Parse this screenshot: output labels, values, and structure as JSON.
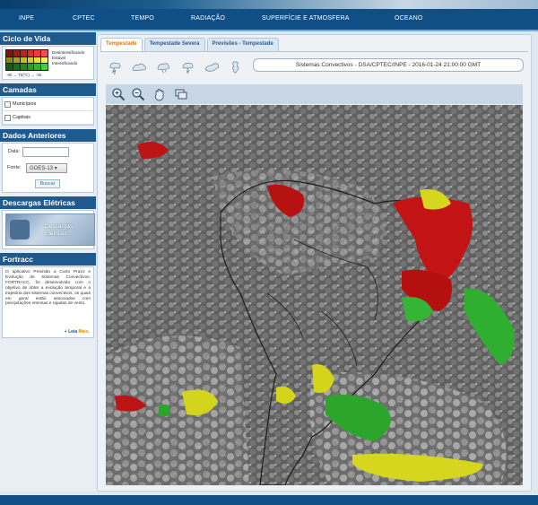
{
  "topnav": [
    "INPE",
    "CPTEC",
    "TEMPO",
    "RADIAÇÃO",
    "SUPERFÍCIE E ATMOSFERA",
    "OCEANO"
  ],
  "left": {
    "ciclo": {
      "title": "Ciclo de Vida",
      "legend": [
        "Desintensificando",
        "Estável",
        "Intensificando"
      ],
      "scale": "-80  ← Tb(ºC) →  -36"
    },
    "camadas": {
      "title": "Camadas",
      "items": [
        "Municípios",
        "Capitais"
      ]
    },
    "dados": {
      "title": "Dados Anteriores",
      "date_label": "Data:",
      "date_value": "",
      "fonte_label": "Fonte:",
      "fonte_value": "GOES-13",
      "button": "Buscar"
    },
    "descargas": {
      "title": "Descargas Elétricas",
      "banner": "Descargas Elétricas"
    },
    "fortracc": {
      "title": "Fortracc",
      "text": "O aplicativo Previsão a Curto Prazo e Evolução de Sistemas Convectivos, FORTRACC, foi desenvolvido com o objetivo de obter a evolução temporal e a trajetória dos sistemas convectivos, os quais em geral estão associados com precipitações intensas e rajadas de vento.",
      "more_prefix": "+ Leia ",
      "more_link": "Mais."
    }
  },
  "main": {
    "tabs": [
      "Tempestade",
      "Tempestade Severa",
      "Previsões - Tempestade"
    ],
    "active_tab": 0,
    "info": "Sistemas Convectivos - DSA/CPTEC/INPE - 2016-01-24 21:00:00 GMT",
    "product_icons": [
      "storm-icon-1",
      "storm-icon-2",
      "storm-icon-3",
      "storm-icon-4",
      "storm-icon-5",
      "storm-icon-6"
    ],
    "tools": [
      "zoom-in-icon",
      "zoom-out-icon",
      "pan-hand-icon",
      "layers-icon"
    ]
  },
  "colors": {
    "header": "#0f4f86",
    "section": "#1f5a8f",
    "active_tab": "#e07a00",
    "decaying": "#cc1111",
    "stable": "#d8d820",
    "growing": "#22bb22"
  }
}
